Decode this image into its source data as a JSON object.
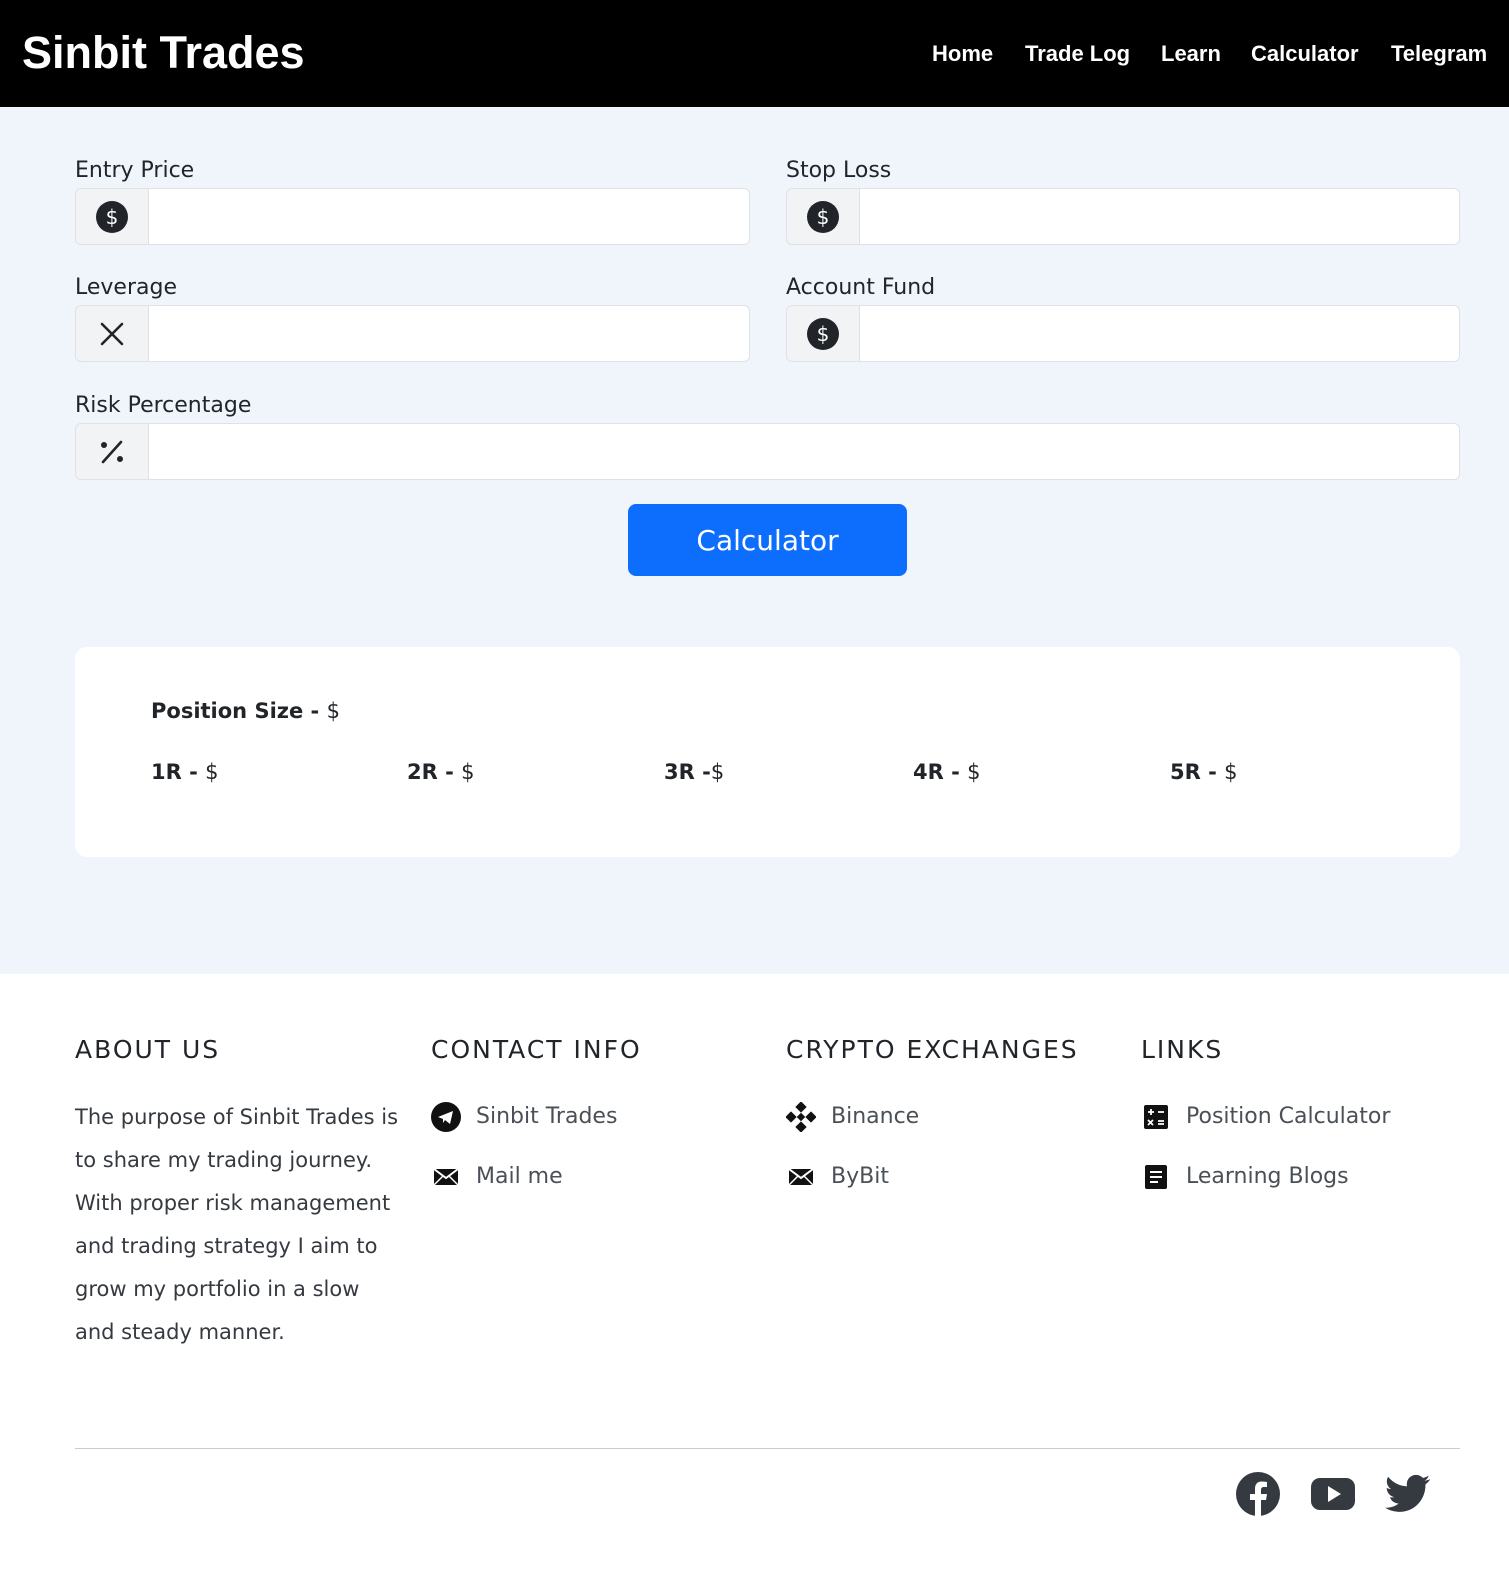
{
  "navbar": {
    "brand": "Sinbit Trades",
    "links": [
      "Home",
      "Trade Log",
      "Learn",
      "Calculator",
      "Telegram"
    ]
  },
  "form": {
    "entry_price": {
      "label": "Entry Price",
      "icon": "dollar-circle-icon",
      "value": ""
    },
    "stop_loss": {
      "label": "Stop Loss",
      "icon": "dollar-circle-icon",
      "value": ""
    },
    "leverage": {
      "label": "Leverage",
      "icon": "x-icon",
      "value": ""
    },
    "account_fund": {
      "label": "Account Fund",
      "icon": "dollar-circle-icon",
      "value": ""
    },
    "risk_percentage": {
      "label": "Risk Percentage",
      "icon": "percent-icon",
      "value": ""
    },
    "submit_label": "Calculator"
  },
  "results": {
    "position_size": {
      "label": "Position Size",
      "sep": " - ",
      "value": "$"
    },
    "r_multiples": [
      {
        "label": "1R",
        "sep": " - ",
        "value": "$"
      },
      {
        "label": "2R",
        "sep": " - ",
        "value": "$"
      },
      {
        "label": "3R",
        "sep": " -",
        "value": "$"
      },
      {
        "label": "4R",
        "sep": " - ",
        "value": "$"
      },
      {
        "label": "5R",
        "sep": " - ",
        "value": "$"
      }
    ]
  },
  "footer": {
    "about": {
      "title": "ABOUT US",
      "text": "The purpose of Sinbit Trades is to share my trading journey. With proper risk management and trading strategy I aim to grow my portfolio in a slow and steady manner."
    },
    "contact": {
      "title": "CONTACT INFO",
      "items": [
        {
          "label": "Sinbit Trades",
          "icon": "telegram-icon"
        },
        {
          "label": "Mail me",
          "icon": "envelope-icon"
        }
      ]
    },
    "exchanges": {
      "title": "CRYPTO EXCHANGES",
      "items": [
        {
          "label": "Binance",
          "icon": "binance-icon"
        },
        {
          "label": "ByBit",
          "icon": "envelope-icon"
        }
      ]
    },
    "links": {
      "title": "LINKS",
      "items": [
        {
          "label": "Position Calculator",
          "icon": "calculator-icon"
        },
        {
          "label": "Learning Blogs",
          "icon": "document-icon"
        }
      ]
    },
    "social": [
      "facebook-icon",
      "youtube-icon",
      "twitter-icon"
    ]
  },
  "colors": {
    "navbar_bg": "#000000",
    "page_bg": "#f0f5fc",
    "primary_button": "#0d6efd"
  }
}
